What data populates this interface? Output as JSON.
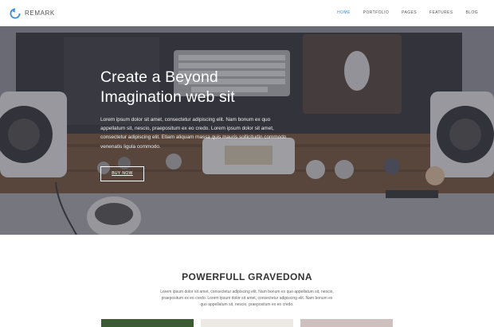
{
  "brand": {
    "name": "REMARK",
    "accent": "#3a8fd8"
  },
  "nav": {
    "items": [
      {
        "label": "HOME",
        "active": true
      },
      {
        "label": "PORTFOLIO",
        "active": false
      },
      {
        "label": "PAGES",
        "active": false
      },
      {
        "label": "FEATURES",
        "active": false
      },
      {
        "label": "BLOG",
        "active": false
      }
    ]
  },
  "hero": {
    "title_line1": "Create a Beyond",
    "title_line2": "Imagination web sit",
    "text": "Lorem ipsum dolor sit amet, consectetur adipiscing elit. Nam bonum ex quo appellatum sit, nescio, praepositum ex eo credo. Lorem ipsum dolor sit amet, consectetur adipiscing elit. Etiam aliquam massa quis mauris sollicitudin commodo venenatis ligula commodo.",
    "button": "BUY NOW"
  },
  "section": {
    "title": "POWERFULL GRAVEDONA",
    "text": "Lorem ipsum dolor sit amet, consectetur adipiscing elit. Nam bonum ex quo appellatum sit, nescio, praepositum ex eo credo. Lorem ipsum dolor sit amet, consectetur adipiscing elit. Nam bonum ex quo appellatum sit, nescio, praepositum ex eo credo.",
    "cards": [
      {
        "icon": "green-photo",
        "color": "#3c5a34"
      },
      {
        "icon": "light-photo",
        "color": "#ece9e4"
      },
      {
        "icon": "pink-photo",
        "color": "#cfc0c0"
      }
    ]
  }
}
